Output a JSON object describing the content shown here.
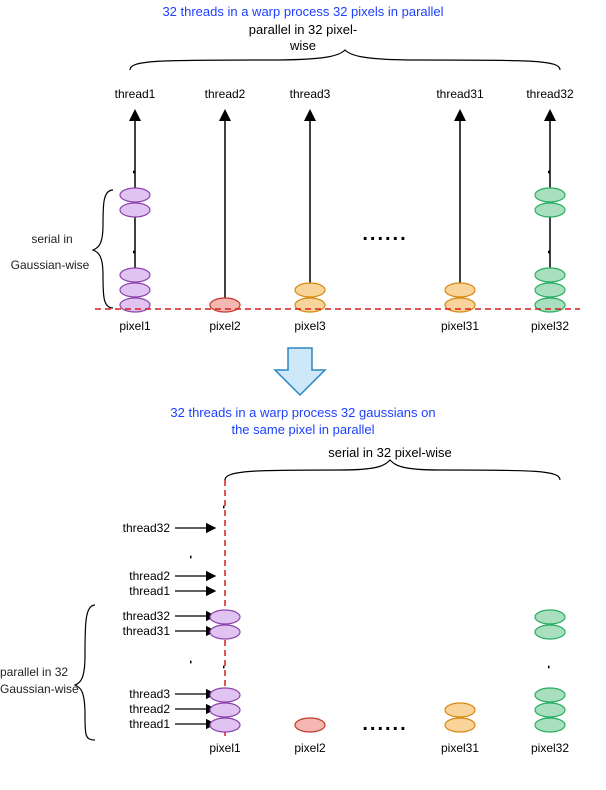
{
  "top": {
    "title_blue": "32 threads in a warp process 32 pixels in parallel",
    "title_black_l1": "parallel in 32 pixel-",
    "title_black_l2": "wise",
    "threads": [
      "thread1",
      "thread2",
      "thread3",
      "thread31",
      "thread32"
    ],
    "pixels": [
      "pixel1",
      "pixel2",
      "pixel3",
      "pixel31",
      "pixel32"
    ],
    "side_label_l1": "serial in",
    "side_label_l2": "Gaussian-wise",
    "dots": "......"
  },
  "bottom": {
    "title_blue_l1": "32 threads in a warp process 32 gaussians on",
    "title_blue_l2": "the same pixel in parallel",
    "title_black": "serial in 32 pixel-wise",
    "threads": [
      "thread1",
      "thread2",
      "thread3",
      "thread31",
      "thread32"
    ],
    "left_threads_upper_top": "thread32",
    "left_threads_upper_mid": [
      "thread2",
      "thread1"
    ],
    "pixels": [
      "pixel1",
      "pixel2",
      "pixel31",
      "pixel32"
    ],
    "side_label_l1": "parallel in 32",
    "side_label_l2": "Gaussian-wise",
    "dots": "......"
  },
  "colors": {
    "purple_fill": "#e0c3f0",
    "purple_stroke": "#8e44ad",
    "red_fill": "#f5b7b1",
    "red_stroke": "#c0392b",
    "orange_fill": "#f9d49a",
    "orange_stroke": "#d68910",
    "green_fill": "#a9dfbf",
    "green_stroke": "#27ae60",
    "arrow_blue_fill": "#cfe8f9",
    "arrow_blue_stroke": "#2e86c1",
    "dash_red": "#d61f1f"
  }
}
